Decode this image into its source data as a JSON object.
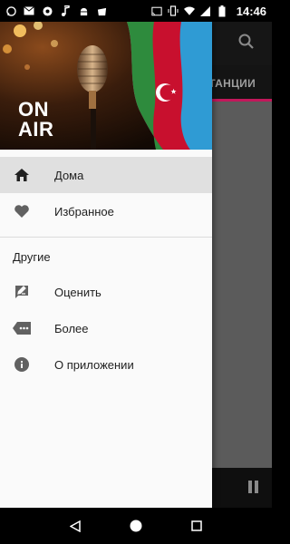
{
  "status_bar": {
    "time": "14:46",
    "left_icons": [
      "whatsapp-icon",
      "mail-icon",
      "chrome-icon",
      "music-icon",
      "android-icon",
      "shopping-bag-icon"
    ],
    "right_icons": [
      "cast-icon",
      "vibrate-icon",
      "wifi-icon",
      "signal-icon",
      "battery-icon"
    ]
  },
  "drawer": {
    "header": {
      "onair_line1": "ON",
      "onair_line2": "AIR"
    },
    "items": [
      {
        "label": "Дома",
        "icon": "home-icon",
        "active": true
      },
      {
        "label": "Избранное",
        "icon": "heart-icon",
        "active": false
      }
    ],
    "section_title": "Другие",
    "other_items": [
      {
        "label": "Оценить",
        "icon": "rate-icon"
      },
      {
        "label": "Более",
        "icon": "more-icon"
      },
      {
        "label": "О приложении",
        "icon": "info-icon"
      }
    ]
  },
  "app": {
    "tab_label": "СТАНЦИИ",
    "accent_color": "#c2185b"
  },
  "navbar": {
    "buttons": [
      "back-icon",
      "home-circle-icon",
      "recents-icon"
    ]
  }
}
